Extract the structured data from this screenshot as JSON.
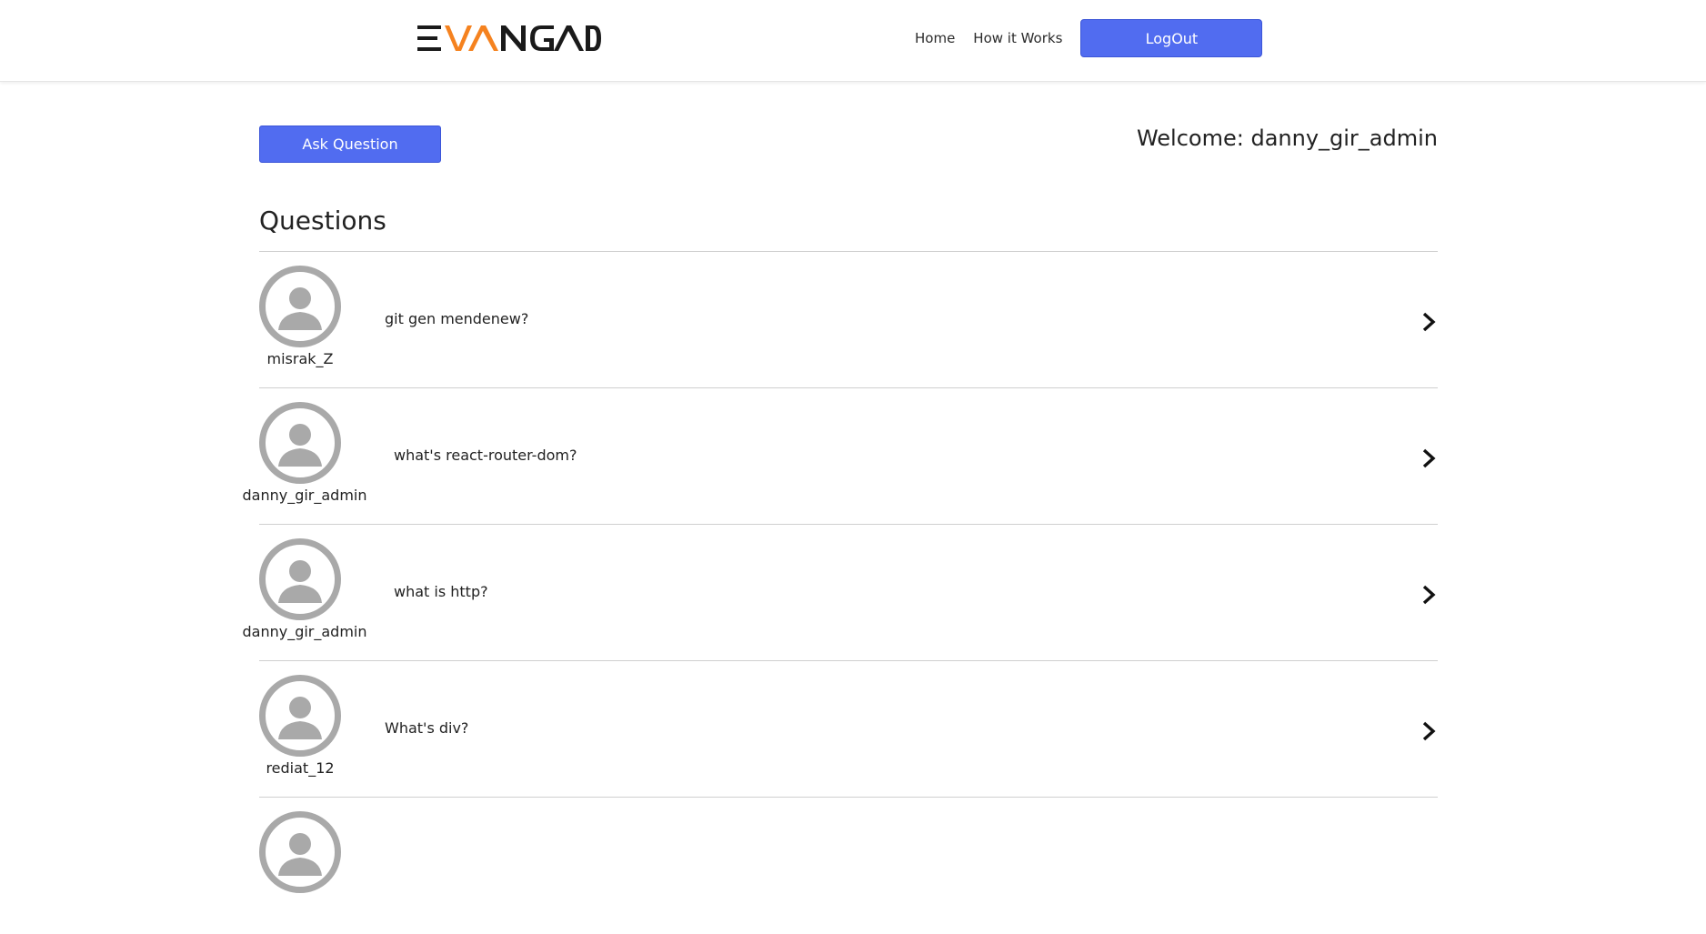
{
  "header": {
    "logo_text": "EVANGADI",
    "logo_colors": {
      "main": "#1a1a1a",
      "accent": "#f5821f"
    },
    "nav": {
      "home": "Home",
      "how_it_works": "How it Works",
      "logout": "LogOut"
    }
  },
  "top": {
    "ask_question": "Ask Question",
    "welcome": "Welcome: danny_gir_admin"
  },
  "section_title": "Questions",
  "questions": [
    {
      "user": "misrak_Z",
      "text": "git gen mendenew?"
    },
    {
      "user": "danny_gir_admin",
      "text": "what's react-router-dom?"
    },
    {
      "user": "danny_gir_admin",
      "text": "what is http?"
    },
    {
      "user": "rediat_12",
      "text": "What's div?"
    }
  ],
  "colors": {
    "primary": "#516cf0",
    "avatar_gray": "#a9a9a9",
    "divider": "#cfcfcf"
  },
  "icons": {
    "avatar": "user-silhouette-icon",
    "row_arrow": "chevron-right-icon"
  }
}
